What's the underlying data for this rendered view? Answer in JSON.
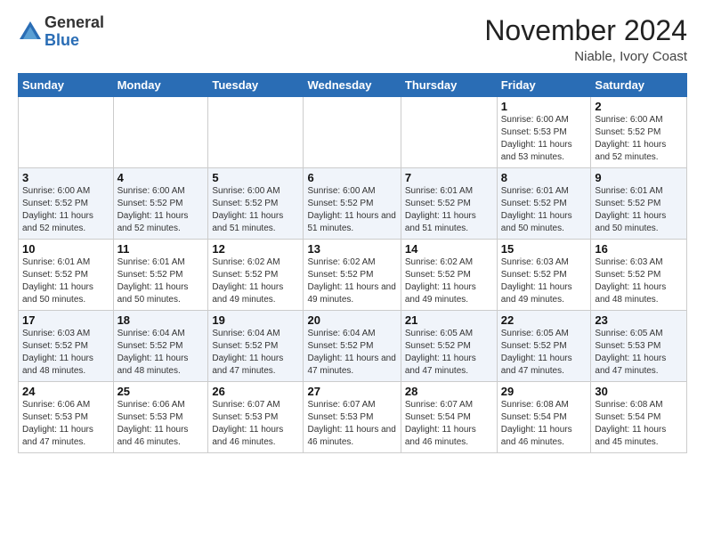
{
  "logo": {
    "general": "General",
    "blue": "Blue"
  },
  "header": {
    "month": "November 2024",
    "location": "Niable, Ivory Coast"
  },
  "weekdays": [
    "Sunday",
    "Monday",
    "Tuesday",
    "Wednesday",
    "Thursday",
    "Friday",
    "Saturday"
  ],
  "weeks": [
    [
      {
        "day": "",
        "sunrise": "",
        "sunset": "",
        "daylight": ""
      },
      {
        "day": "",
        "sunrise": "",
        "sunset": "",
        "daylight": ""
      },
      {
        "day": "",
        "sunrise": "",
        "sunset": "",
        "daylight": ""
      },
      {
        "day": "",
        "sunrise": "",
        "sunset": "",
        "daylight": ""
      },
      {
        "day": "",
        "sunrise": "",
        "sunset": "",
        "daylight": ""
      },
      {
        "day": "1",
        "sunrise": "Sunrise: 6:00 AM",
        "sunset": "Sunset: 5:53 PM",
        "daylight": "Daylight: 11 hours and 53 minutes."
      },
      {
        "day": "2",
        "sunrise": "Sunrise: 6:00 AM",
        "sunset": "Sunset: 5:52 PM",
        "daylight": "Daylight: 11 hours and 52 minutes."
      }
    ],
    [
      {
        "day": "3",
        "sunrise": "Sunrise: 6:00 AM",
        "sunset": "Sunset: 5:52 PM",
        "daylight": "Daylight: 11 hours and 52 minutes."
      },
      {
        "day": "4",
        "sunrise": "Sunrise: 6:00 AM",
        "sunset": "Sunset: 5:52 PM",
        "daylight": "Daylight: 11 hours and 52 minutes."
      },
      {
        "day": "5",
        "sunrise": "Sunrise: 6:00 AM",
        "sunset": "Sunset: 5:52 PM",
        "daylight": "Daylight: 11 hours and 51 minutes."
      },
      {
        "day": "6",
        "sunrise": "Sunrise: 6:00 AM",
        "sunset": "Sunset: 5:52 PM",
        "daylight": "Daylight: 11 hours and 51 minutes."
      },
      {
        "day": "7",
        "sunrise": "Sunrise: 6:01 AM",
        "sunset": "Sunset: 5:52 PM",
        "daylight": "Daylight: 11 hours and 51 minutes."
      },
      {
        "day": "8",
        "sunrise": "Sunrise: 6:01 AM",
        "sunset": "Sunset: 5:52 PM",
        "daylight": "Daylight: 11 hours and 50 minutes."
      },
      {
        "day": "9",
        "sunrise": "Sunrise: 6:01 AM",
        "sunset": "Sunset: 5:52 PM",
        "daylight": "Daylight: 11 hours and 50 minutes."
      }
    ],
    [
      {
        "day": "10",
        "sunrise": "Sunrise: 6:01 AM",
        "sunset": "Sunset: 5:52 PM",
        "daylight": "Daylight: 11 hours and 50 minutes."
      },
      {
        "day": "11",
        "sunrise": "Sunrise: 6:01 AM",
        "sunset": "Sunset: 5:52 PM",
        "daylight": "Daylight: 11 hours and 50 minutes."
      },
      {
        "day": "12",
        "sunrise": "Sunrise: 6:02 AM",
        "sunset": "Sunset: 5:52 PM",
        "daylight": "Daylight: 11 hours and 49 minutes."
      },
      {
        "day": "13",
        "sunrise": "Sunrise: 6:02 AM",
        "sunset": "Sunset: 5:52 PM",
        "daylight": "Daylight: 11 hours and 49 minutes."
      },
      {
        "day": "14",
        "sunrise": "Sunrise: 6:02 AM",
        "sunset": "Sunset: 5:52 PM",
        "daylight": "Daylight: 11 hours and 49 minutes."
      },
      {
        "day": "15",
        "sunrise": "Sunrise: 6:03 AM",
        "sunset": "Sunset: 5:52 PM",
        "daylight": "Daylight: 11 hours and 49 minutes."
      },
      {
        "day": "16",
        "sunrise": "Sunrise: 6:03 AM",
        "sunset": "Sunset: 5:52 PM",
        "daylight": "Daylight: 11 hours and 48 minutes."
      }
    ],
    [
      {
        "day": "17",
        "sunrise": "Sunrise: 6:03 AM",
        "sunset": "Sunset: 5:52 PM",
        "daylight": "Daylight: 11 hours and 48 minutes."
      },
      {
        "day": "18",
        "sunrise": "Sunrise: 6:04 AM",
        "sunset": "Sunset: 5:52 PM",
        "daylight": "Daylight: 11 hours and 48 minutes."
      },
      {
        "day": "19",
        "sunrise": "Sunrise: 6:04 AM",
        "sunset": "Sunset: 5:52 PM",
        "daylight": "Daylight: 11 hours and 47 minutes."
      },
      {
        "day": "20",
        "sunrise": "Sunrise: 6:04 AM",
        "sunset": "Sunset: 5:52 PM",
        "daylight": "Daylight: 11 hours and 47 minutes."
      },
      {
        "day": "21",
        "sunrise": "Sunrise: 6:05 AM",
        "sunset": "Sunset: 5:52 PM",
        "daylight": "Daylight: 11 hours and 47 minutes."
      },
      {
        "day": "22",
        "sunrise": "Sunrise: 6:05 AM",
        "sunset": "Sunset: 5:52 PM",
        "daylight": "Daylight: 11 hours and 47 minutes."
      },
      {
        "day": "23",
        "sunrise": "Sunrise: 6:05 AM",
        "sunset": "Sunset: 5:53 PM",
        "daylight": "Daylight: 11 hours and 47 minutes."
      }
    ],
    [
      {
        "day": "24",
        "sunrise": "Sunrise: 6:06 AM",
        "sunset": "Sunset: 5:53 PM",
        "daylight": "Daylight: 11 hours and 47 minutes."
      },
      {
        "day": "25",
        "sunrise": "Sunrise: 6:06 AM",
        "sunset": "Sunset: 5:53 PM",
        "daylight": "Daylight: 11 hours and 46 minutes."
      },
      {
        "day": "26",
        "sunrise": "Sunrise: 6:07 AM",
        "sunset": "Sunset: 5:53 PM",
        "daylight": "Daylight: 11 hours and 46 minutes."
      },
      {
        "day": "27",
        "sunrise": "Sunrise: 6:07 AM",
        "sunset": "Sunset: 5:53 PM",
        "daylight": "Daylight: 11 hours and 46 minutes."
      },
      {
        "day": "28",
        "sunrise": "Sunrise: 6:07 AM",
        "sunset": "Sunset: 5:54 PM",
        "daylight": "Daylight: 11 hours and 46 minutes."
      },
      {
        "day": "29",
        "sunrise": "Sunrise: 6:08 AM",
        "sunset": "Sunset: 5:54 PM",
        "daylight": "Daylight: 11 hours and 46 minutes."
      },
      {
        "day": "30",
        "sunrise": "Sunrise: 6:08 AM",
        "sunset": "Sunset: 5:54 PM",
        "daylight": "Daylight: 11 hours and 45 minutes."
      }
    ]
  ]
}
